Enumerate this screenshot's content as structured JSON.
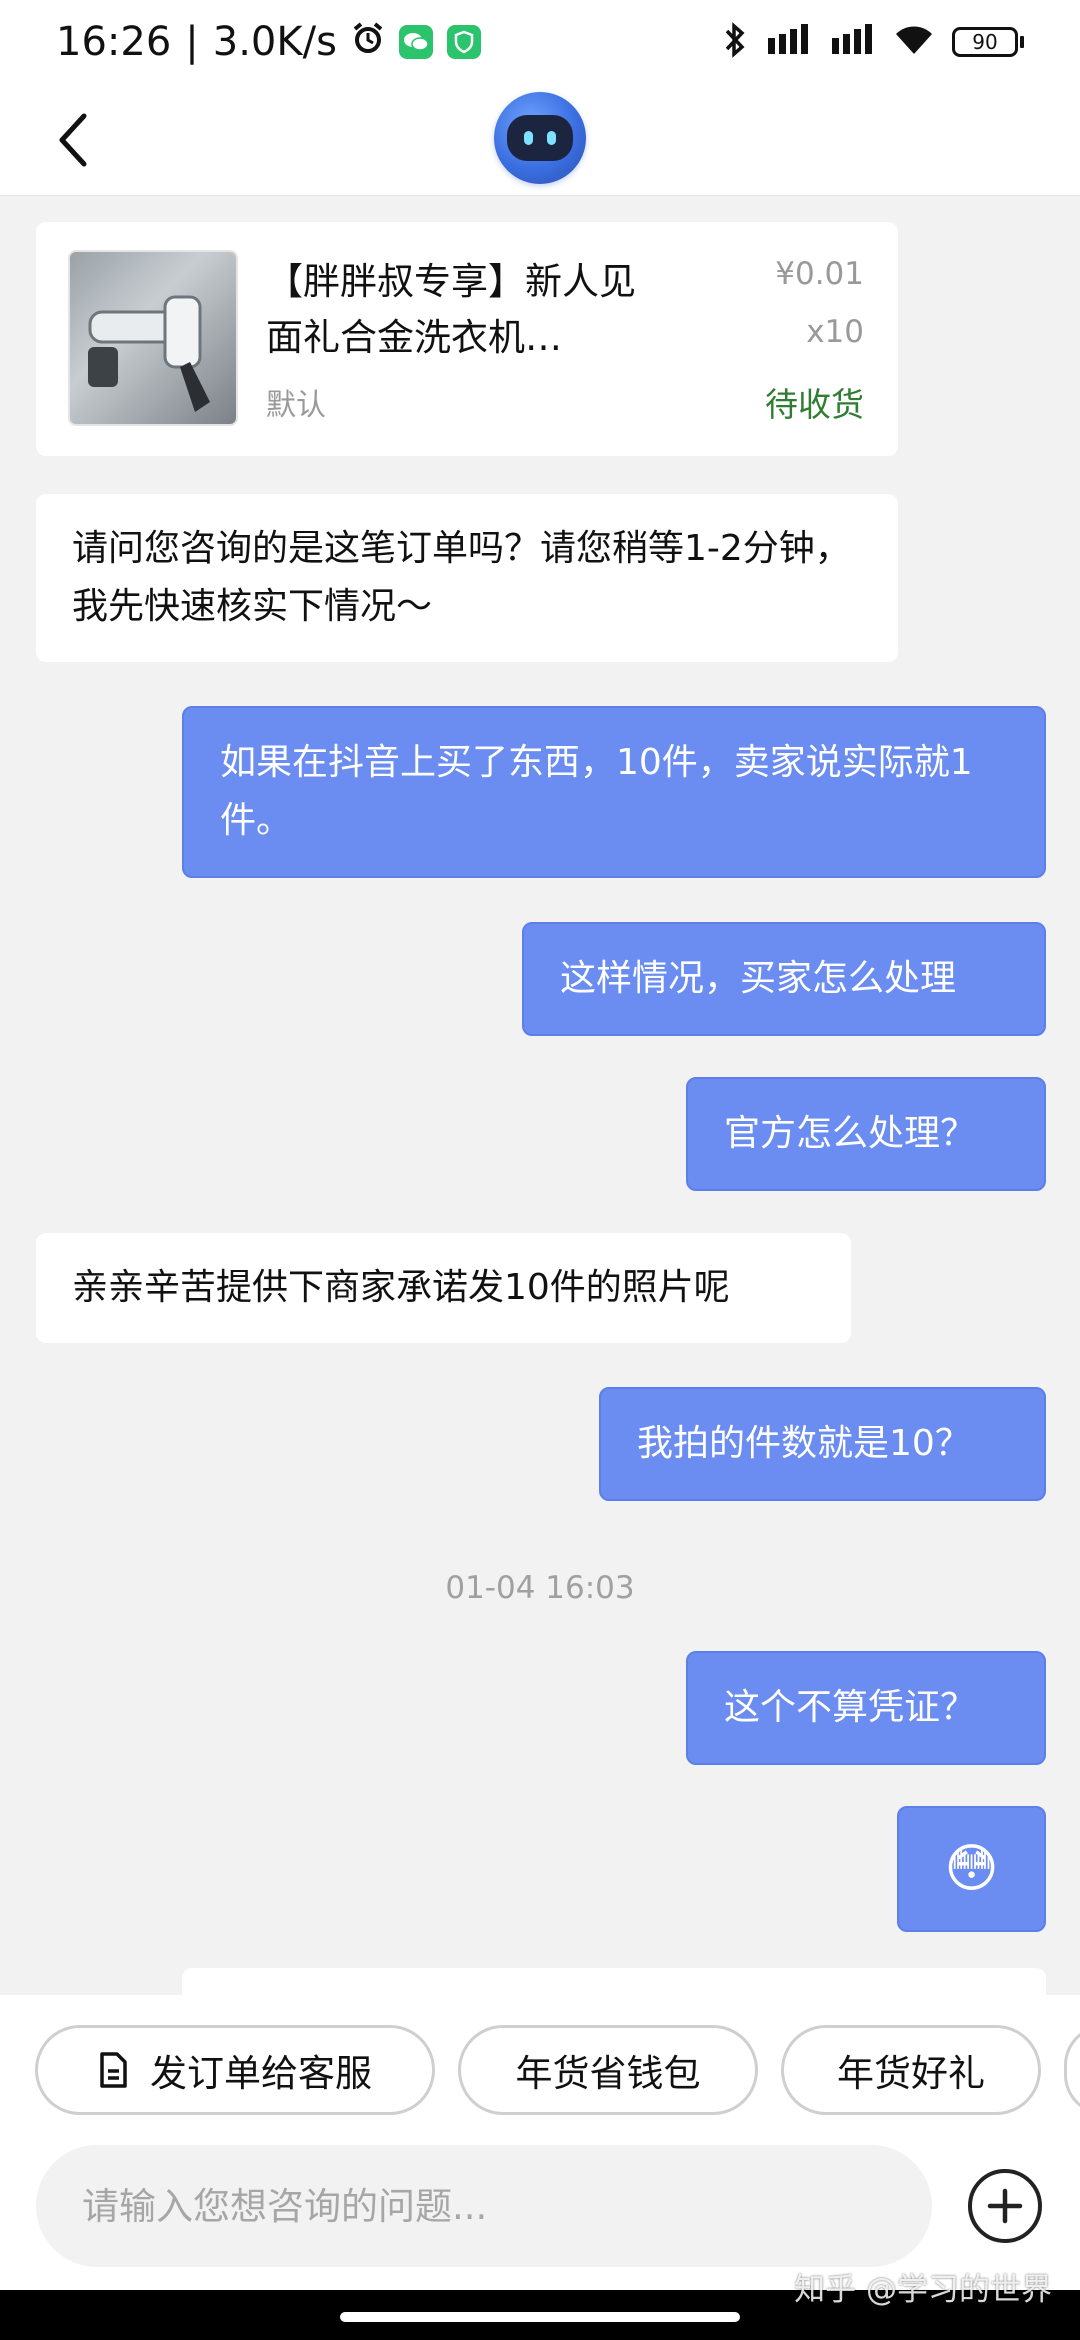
{
  "status_bar": {
    "time": "16:26",
    "speed": "3.0K/s",
    "battery": "90",
    "icons": [
      "alarm-icon",
      "wechat-icon",
      "shield-app-icon",
      "bluetooth-icon",
      "signal-icon",
      "signal-icon",
      "wifi-icon",
      "battery-icon"
    ]
  },
  "header": {
    "back_icon": "chevron-left-icon",
    "avatar_icon": "robot-assistant-icon"
  },
  "product_card": {
    "title": "【胖胖叔专享】新人见面礼合金洗衣机…",
    "variant": "默认",
    "price": "¥0.01",
    "quantity": "x10",
    "status": "待收货",
    "status_color": "#2e7d32"
  },
  "messages": [
    {
      "side": "left",
      "text": "请问您咨询的是这笔订单吗？请您稍等1-2分钟，我先快速核实下情况～"
    },
    {
      "side": "right",
      "text": "如果在抖音上买了东西，10件，卖家说实际就1件。"
    },
    {
      "side": "right",
      "text": "这样情况，买家怎么处理"
    },
    {
      "side": "right",
      "text": "官方怎么处理？"
    },
    {
      "side": "left",
      "text": "亲亲辛苦提供下商家承诺发10件的照片呢"
    },
    {
      "side": "right",
      "text": "我拍的件数就是10？"
    },
    {
      "side": "right",
      "text": "这个不算凭证？"
    },
    {
      "side": "right",
      "text": "😳"
    }
  ],
  "timestamp": "01-04 16:03",
  "quick_actions": [
    {
      "label": "发订单给客服",
      "icon": "document-icon"
    },
    {
      "label": "年货省钱包"
    },
    {
      "label": "年货好礼"
    }
  ],
  "input": {
    "placeholder": "请输入您想咨询的问题..."
  },
  "watermark": "知乎 @学习的世界",
  "colors": {
    "user_bubble": "#6b8cf0",
    "agent_bubble": "#ffffff",
    "background": "#f2f2f2"
  }
}
